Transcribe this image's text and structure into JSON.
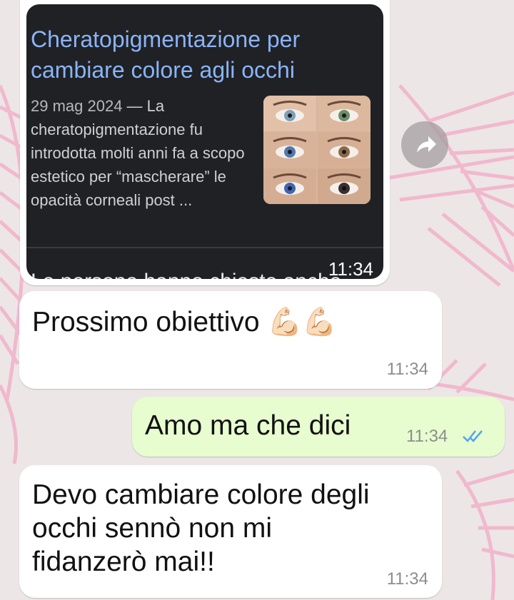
{
  "link_card": {
    "title": "Cheratopigmentazione per cambiare colore agli occhi",
    "date": "29 mag 2024",
    "snippet": " — La cheratopigmentazione fu introdotta molti anni fa a scopo estetico per “mascherare” le opacità corneali post ...",
    "overflow_text": "Le persone hanno chiesto anche",
    "time": "11:34",
    "thumbnail_icon": "eyes-photo-grid",
    "forward_icon": "forward-arrow-icon"
  },
  "messages": [
    {
      "direction": "incoming",
      "text": "Prossimo obiettivo 💪🏻💪🏻",
      "time": "11:34"
    },
    {
      "direction": "outgoing",
      "text": "Amo ma che dici",
      "time": "11:34",
      "status": "read",
      "status_icon": "double-check-icon",
      "status_color": "#53a5f0"
    },
    {
      "direction": "incoming",
      "text": "Devo cambiare colore degli occhi sennò non mi fidanzerò mai!!",
      "time": "11:34"
    }
  ],
  "colors": {
    "incoming_bubble": "#ffffff",
    "outgoing_bubble": "#e7fccf",
    "card_background": "#202124",
    "card_title": "#8ab4f8",
    "wallpaper": "#ece6e6",
    "wallpaper_accent": "#f2a6c4"
  }
}
